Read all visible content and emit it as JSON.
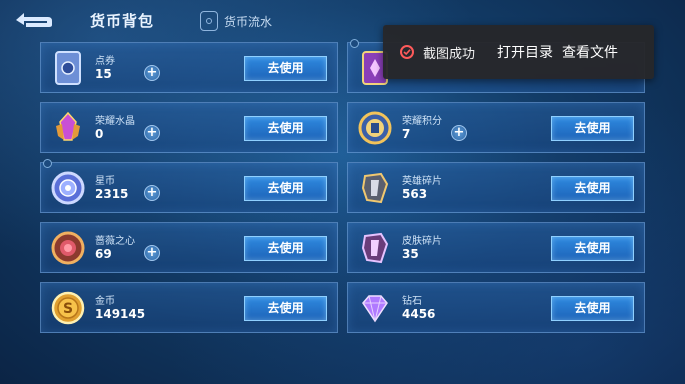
{
  "header": {
    "title": "货币背包",
    "flow_tab": "货币流水"
  },
  "cards": [
    {
      "name": "点券",
      "count": "15",
      "button": "去使用",
      "has_plus": true,
      "icon": "voucher-icon"
    },
    {
      "name": "",
      "count": "",
      "button": "",
      "has_plus": false,
      "icon": "card-purple-icon"
    },
    {
      "name": "荣耀水晶",
      "count": "0",
      "button": "去使用",
      "has_plus": true,
      "icon": "glory-crystal-icon"
    },
    {
      "name": "荣耀积分",
      "count": "7",
      "button": "去使用",
      "has_plus": true,
      "icon": "glory-points-icon"
    },
    {
      "name": "星币",
      "count": "2315",
      "button": "去使用",
      "has_plus": true,
      "icon": "star-coin-icon"
    },
    {
      "name": "英雄碎片",
      "count": "563",
      "button": "去使用",
      "has_plus": false,
      "icon": "hero-fragment-icon"
    },
    {
      "name": "蔷薇之心",
      "count": "69",
      "button": "去使用",
      "has_plus": true,
      "icon": "rose-heart-icon"
    },
    {
      "name": "皮肤碎片",
      "count": "35",
      "button": "去使用",
      "has_plus": false,
      "icon": "skin-fragment-icon"
    },
    {
      "name": "金币",
      "count": "149145",
      "button": "去使用",
      "has_plus": false,
      "icon": "gold-coin-icon"
    },
    {
      "name": "钻石",
      "count": "4456",
      "button": "去使用",
      "has_plus": false,
      "icon": "diamond-icon"
    }
  ],
  "toast": {
    "message": "截图成功",
    "open_dir": "打开目录",
    "view_file": "查看文件"
  },
  "colors": {
    "accent_button": "#2f8ae0",
    "toast_icon": "#ff5a5a",
    "background": "#123b66"
  }
}
